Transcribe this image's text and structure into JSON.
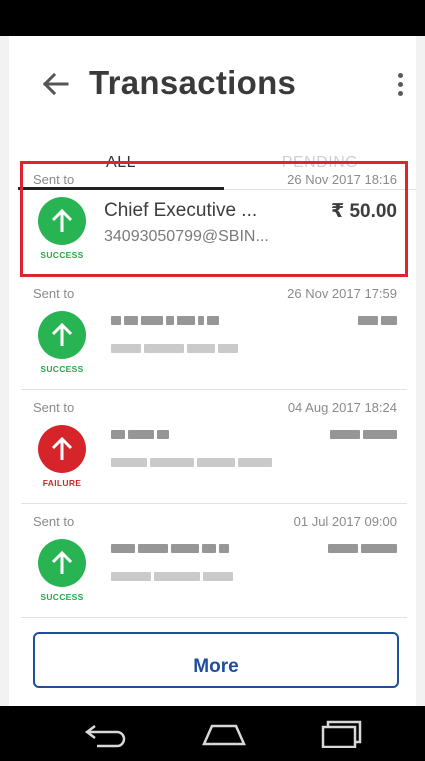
{
  "app_bar": {
    "title": "Transactions",
    "back_icon": "arrow-left-icon",
    "menu_icon": "more-vertical-icon"
  },
  "tabs": [
    {
      "label": "ALL",
      "selected": true
    },
    {
      "label": "PENDING",
      "selected": false
    }
  ],
  "transactions": [
    {
      "direction_label": "Sent to",
      "date": "26 Nov 2017 18:16",
      "payee_name": "Chief Executive ...",
      "payee_id": "34093050799@SBIN...",
      "amount": "₹ 50.00",
      "status": "SUCCESS",
      "highlighted": true
    },
    {
      "direction_label": "Sent to",
      "date": "26 Nov 2017 17:59",
      "status": "SUCCESS"
    },
    {
      "direction_label": "Sent to",
      "date": "04 Aug 2017 18:24",
      "status": "FAILURE"
    },
    {
      "direction_label": "Sent to",
      "date": "01 Jul 2017 09:00",
      "status": "SUCCESS"
    }
  ],
  "more_button": {
    "label": "More"
  },
  "colors": {
    "success": "#29b454",
    "failure": "#d6242b",
    "highlight_border": "#e0242f",
    "more_button": "#1f4e9c"
  },
  "nav_bar": {
    "back_icon": "nav-back-icon",
    "home_icon": "nav-home-icon",
    "recents_icon": "nav-recents-icon"
  }
}
